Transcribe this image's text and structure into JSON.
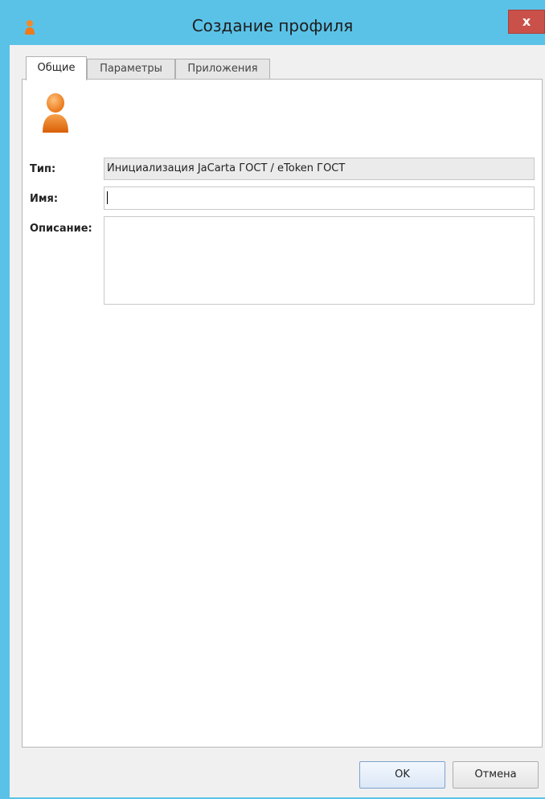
{
  "window": {
    "title": "Создание профиля",
    "close_label": "x"
  },
  "tabs": [
    {
      "label": "Общие",
      "active": true
    },
    {
      "label": "Параметры",
      "active": false
    },
    {
      "label": "Приложения",
      "active": false
    }
  ],
  "form": {
    "type_label": "Тип:",
    "type_value": "Инициализация JaCarta ГОСТ / eToken ГОСТ",
    "name_label": "Имя:",
    "name_value": "",
    "description_label": "Описание:",
    "description_value": ""
  },
  "buttons": {
    "ok_label": "OK",
    "cancel_label": "Отмена"
  },
  "icons": {
    "title_icon": "user-profile-icon",
    "profile_icon": "user-profile-icon"
  },
  "colors": {
    "titlebar": "#5bc2e7",
    "close_button": "#c9514a",
    "profile_icon": "#f07c1e"
  }
}
